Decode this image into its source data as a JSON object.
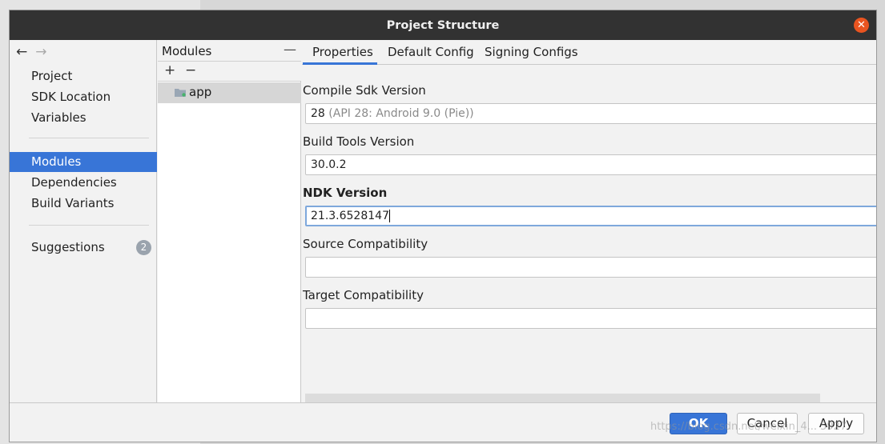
{
  "window": {
    "title": "Project Structure"
  },
  "nav": {
    "back": "←",
    "forward": "→",
    "items": [
      {
        "label": "Project"
      },
      {
        "label": "SDK Location"
      },
      {
        "label": "Variables"
      },
      {
        "label": "Modules",
        "selected": true
      },
      {
        "label": "Dependencies"
      },
      {
        "label": "Build Variants"
      },
      {
        "label": "Suggestions",
        "badge": "2"
      }
    ]
  },
  "modules": {
    "header": "Modules",
    "collapse": "—",
    "add": "+",
    "remove": "−",
    "items": [
      {
        "label": "app"
      }
    ]
  },
  "tabs": [
    {
      "label": "Properties",
      "active": true
    },
    {
      "label": "Default Config"
    },
    {
      "label": "Signing Configs"
    }
  ],
  "fields": {
    "compile_sdk": {
      "label": "Compile Sdk Version",
      "value": "28",
      "hint": "(API 28: Android 9.0 (Pie))"
    },
    "build_tools": {
      "label": "Build Tools Version",
      "value": "30.0.2"
    },
    "ndk": {
      "label": "NDK Version",
      "value": "21.3.6528147"
    },
    "source_compat": {
      "label": "Source Compatibility",
      "value": ""
    },
    "target_compat": {
      "label": "Target Compatibility",
      "value": ""
    }
  },
  "footer": {
    "ok": "OK",
    "cancel": "Cancel",
    "apply": "Apply"
  },
  "watermark": "https://blog.csdn.net/weixin_4... 5927",
  "colors": {
    "accent": "#3875d7",
    "titlebar": "#323232",
    "close": "#e95420"
  }
}
